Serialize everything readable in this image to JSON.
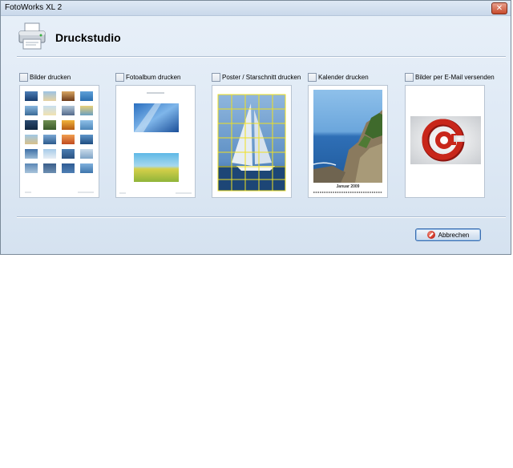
{
  "window": {
    "title": "FotoWorks XL 2",
    "close_symbol": "✕"
  },
  "header": {
    "icon": "printer-icon",
    "title": "Druckstudio"
  },
  "options": [
    {
      "label": "Bilder drucken",
      "checked": false,
      "preview": "photo-grid"
    },
    {
      "label": "Fotoalbum drucken",
      "checked": false,
      "preview": "album-page"
    },
    {
      "label": "Poster / Starschnitt drucken",
      "checked": false,
      "preview": "sailboat-poster"
    },
    {
      "label": "Kalender drucken",
      "checked": false,
      "preview": "coastline-calendar"
    },
    {
      "label": "Bilder per E-Mail versenden",
      "checked": false,
      "preview": "email-at-sign"
    }
  ],
  "calendar_preview": {
    "month_label": "Januar 2009"
  },
  "buttons": {
    "cancel_label": "Abbrechen",
    "cancel_icon": "cancel-icon"
  },
  "colors": {
    "window_bg": "#dde8f4",
    "poster_grid": "#f0e020",
    "email_red": "#c8261a"
  }
}
